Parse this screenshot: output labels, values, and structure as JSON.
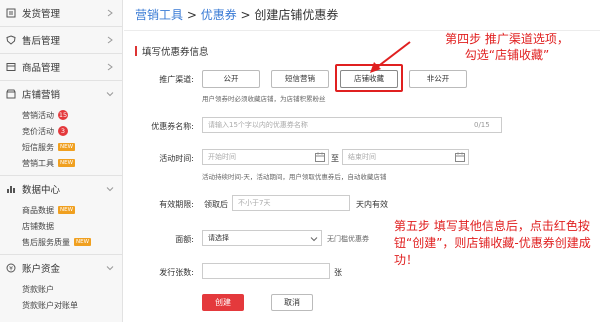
{
  "sidebar": {
    "sections": [
      {
        "title": "发货管理",
        "icon": "shipping-icon",
        "items": []
      },
      {
        "title": "售后管理",
        "icon": "shield-icon",
        "items": []
      },
      {
        "title": "商品管理",
        "icon": "product-icon",
        "items": []
      },
      {
        "title": "店铺营销",
        "icon": "store-icon",
        "items": [
          {
            "label": "营销活动",
            "badge": "15"
          },
          {
            "label": "竞价活动",
            "badge": "3"
          },
          {
            "label": "短信服务",
            "badge": "NEW"
          },
          {
            "label": "营销工具",
            "badge": "NEW"
          }
        ]
      },
      {
        "title": "数据中心",
        "icon": "chart-icon",
        "items": [
          {
            "label": "商品数据",
            "badge": "NEW"
          },
          {
            "label": "店铺数据",
            "badge": ""
          },
          {
            "label": "售后服务质量",
            "badge": "NEW"
          }
        ]
      },
      {
        "title": "账户资金",
        "icon": "money-icon",
        "items": [
          {
            "label": "货款账户",
            "badge": ""
          },
          {
            "label": "货款账户对账单",
            "badge": ""
          }
        ]
      }
    ]
  },
  "breadcrumb": {
    "part1": "营销工具",
    "part2": "优惠券",
    "current": "创建店铺优惠券",
    "sep": " > "
  },
  "form": {
    "section_title": "填写优惠券信息",
    "channel": {
      "label": "推广渠道:",
      "options": [
        "公开",
        "短信营销",
        "店铺收藏",
        "非公开"
      ],
      "hint": "用户领券时必须收藏店铺，为店铺积累粉丝"
    },
    "name": {
      "label": "优惠券名称:",
      "placeholder": "请输入15个字以内的优惠券名称",
      "counter": "0/15"
    },
    "time": {
      "label": "活动时间:",
      "start_placeholder": "开始时间",
      "to": "至",
      "end_placeholder": "结束时间",
      "hint": "活动持续时间-天，活动期间，用户领取优惠券后，自动收藏店铺"
    },
    "validity": {
      "label": "有效期限:",
      "prefix": "领取后",
      "placeholder": "不小于7天",
      "suffix": "天内有效"
    },
    "denomination": {
      "label": "面额:",
      "select_value": "请选择",
      "suffix": "无门槛优惠券"
    },
    "quantity": {
      "label": "发行张数:",
      "suffix": "张"
    },
    "create_label": "创建",
    "cancel_label": "取消"
  },
  "annotations": {
    "step4_line1": "第四步 推广渠道选项，",
    "step4_line2": "勾选“店铺收藏”",
    "step5": "第五步 填写其他信息后，点击红色按钮“创建”，则店铺收藏-优惠券创建成功！"
  },
  "colors": {
    "accent": "#e4393c",
    "link": "#3a7bd5",
    "annotation": "#e02020"
  }
}
